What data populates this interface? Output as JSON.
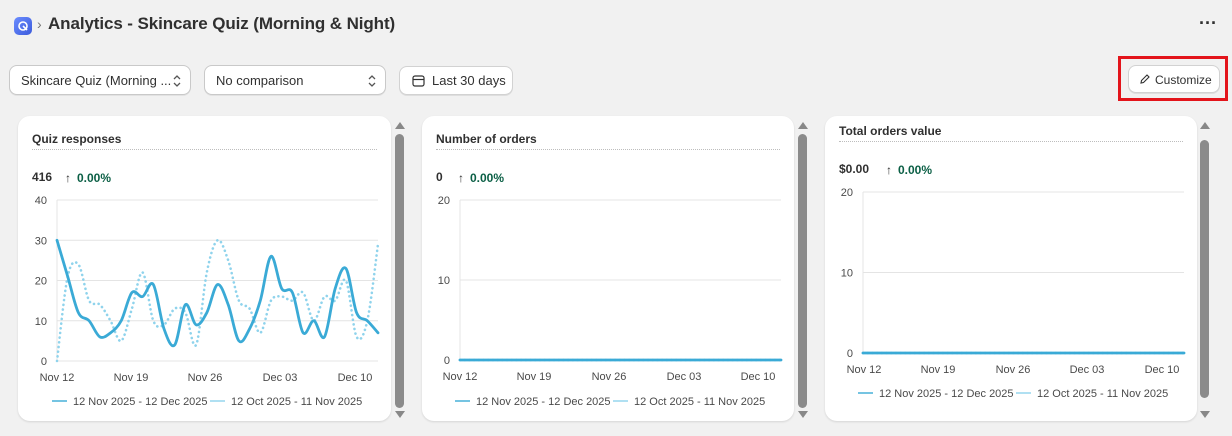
{
  "header": {
    "app_icon": "app-logo-icon",
    "breadcrumb_separator": "›",
    "title": "Analytics - Skincare Quiz (Morning & Night)",
    "more_label": "···"
  },
  "toolbar": {
    "quiz_select_value": "Skincare Quiz (Morning ...",
    "comparison_select_value": "No comparison",
    "date_range_label": "Last 30 days",
    "date_icon": "calendar-icon",
    "customize_label": "Customize",
    "customize_icon": "pencil-icon"
  },
  "colors": {
    "primary_series": "#3aaad6",
    "comparison_series": "#8fd3ec",
    "positive_delta": "#0b5f45",
    "highlight_box": "#e3141b"
  },
  "cards": [
    {
      "title": "Quiz responses",
      "metric": "416",
      "delta": "0.00%",
      "delta_icon": "arrow-up-icon"
    },
    {
      "title": "Number of orders",
      "metric": "0",
      "delta": "0.00%",
      "delta_icon": "arrow-up-icon"
    },
    {
      "title": "Total orders value",
      "metric": "$0.00",
      "delta": "0.00%",
      "delta_icon": "arrow-up-icon"
    }
  ],
  "chart_data": [
    {
      "type": "line",
      "title": "Quiz responses",
      "x": [
        "Nov 12",
        "Nov 13",
        "Nov 14",
        "Nov 15",
        "Nov 16",
        "Nov 17",
        "Nov 18",
        "Nov 19",
        "Nov 20",
        "Nov 21",
        "Nov 22",
        "Nov 23",
        "Nov 24",
        "Nov 25",
        "Nov 26",
        "Nov 27",
        "Nov 28",
        "Nov 29",
        "Nov 30",
        "Dec 01",
        "Dec 02",
        "Dec 03",
        "Dec 04",
        "Dec 05",
        "Dec 06",
        "Dec 07",
        "Dec 08",
        "Dec 09",
        "Dec 10",
        "Dec 11",
        "Dec 12"
      ],
      "x_tick_labels": [
        "Nov 12",
        "Nov 19",
        "Nov 26",
        "Dec 03",
        "Dec 10"
      ],
      "y_ticks": [
        "0",
        "10",
        "20",
        "30",
        "40"
      ],
      "ylim": [
        0,
        40
      ],
      "series": [
        {
          "name": "12 Nov 2025 - 12 Dec 2025",
          "style": "solid",
          "values": [
            30,
            21,
            12,
            10,
            6,
            7,
            10,
            17,
            16,
            19,
            8,
            4,
            14,
            9,
            12,
            19,
            14,
            5,
            8,
            15,
            26,
            18,
            17,
            7,
            10,
            6,
            18,
            23,
            12,
            10,
            7
          ]
        },
        {
          "name": "12 Oct 2025 - 11 Nov 2025",
          "style": "dotted",
          "values": [
            0,
            21,
            24,
            15,
            14,
            10,
            5,
            13,
            22,
            10,
            9,
            13,
            12,
            4,
            22,
            30,
            25,
            15,
            13,
            7,
            15,
            16,
            15,
            17,
            10,
            16,
            15,
            20,
            6,
            10,
            29
          ]
        }
      ],
      "grid": true
    },
    {
      "type": "line",
      "title": "Number of orders",
      "x_tick_labels": [
        "Nov 12",
        "Nov 19",
        "Nov 26",
        "Dec 03",
        "Dec 10"
      ],
      "y_ticks": [
        "0",
        "10",
        "20"
      ],
      "ylim": [
        0,
        20
      ],
      "series": [
        {
          "name": "12 Nov 2025 - 12 Dec 2025",
          "style": "solid",
          "values": [
            0,
            0
          ]
        },
        {
          "name": "12 Oct 2025 - 11 Nov 2025",
          "style": "dotted",
          "values": [
            0,
            0
          ]
        }
      ],
      "grid": true
    },
    {
      "type": "line",
      "title": "Total orders value",
      "x_tick_labels": [
        "Nov 12",
        "Nov 19",
        "Nov 26",
        "Dec 03",
        "Dec 10"
      ],
      "y_ticks": [
        "0",
        "10",
        "20"
      ],
      "ylim": [
        0,
        20
      ],
      "series": [
        {
          "name": "12 Nov 2025 - 12 Dec 2025",
          "style": "solid",
          "values": [
            0,
            0
          ]
        },
        {
          "name": "12 Oct 2025 - 11 Nov 2025",
          "style": "dotted",
          "values": [
            0,
            0
          ]
        }
      ],
      "grid": true
    }
  ]
}
